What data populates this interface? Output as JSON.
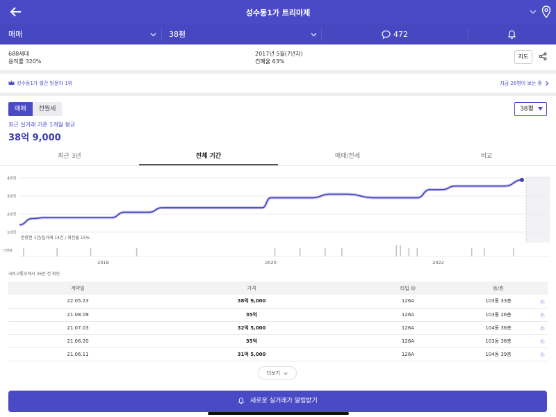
{
  "header": {
    "title": "성수동1가 트리마제"
  },
  "filters": {
    "type": "매매",
    "area": "38평",
    "comment_count": "472"
  },
  "info": {
    "households": "688세대",
    "floor_area_ratio": "용적률 320%",
    "built": "2017년 5월(7년차)",
    "coverage_ratio": "건폐율 63%",
    "map_button": "지도"
  },
  "rank": {
    "text": "성수동1가 월간 방문자 1위",
    "viewers": "지금 26명이 보는 중"
  },
  "trade_toggle": {
    "sale": "매매",
    "lease": "전월세"
  },
  "area_select": "38평",
  "average": {
    "label": "최근 실거래 기준 1개월 평균",
    "price": "38억 9,000"
  },
  "tabs": [
    "최근 3년",
    "전체 기간",
    "매매/전세",
    "비교"
  ],
  "chart_data": {
    "type": "line",
    "y_ticks": [
      "40억",
      "30억",
      "20억",
      "10억"
    ],
    "ylim": [
      10,
      40
    ],
    "x_ticks": [
      {
        "label": "2018",
        "t": 2018.0
      },
      {
        "label": "2020",
        "t": 2020.0
      },
      {
        "label": "2022",
        "t": 2022.0
      }
    ],
    "xlim": [
      2017.0,
      2023.05
    ],
    "series": [
      {
        "x": [
          2017.0,
          2017.15,
          2017.3,
          2017.6,
          2017.9,
          2018.1,
          2018.25,
          2018.4,
          2018.55,
          2018.7,
          2019.2,
          2019.7,
          2019.9,
          2020.0,
          2020.1,
          2020.5,
          2020.7,
          2020.9,
          2021.25,
          2021.45,
          2021.75,
          2021.9,
          2022.05,
          2022.2,
          2022.4,
          2022.8,
          2023.0
        ],
        "y": [
          14,
          17.5,
          18,
          18,
          18,
          18,
          21,
          21,
          21,
          23.5,
          23.5,
          23.5,
          23.5,
          29,
          29,
          29,
          31,
          31,
          29,
          29,
          29,
          33.5,
          33.5,
          35.5,
          35.5,
          35.5,
          38.9
        ]
      }
    ],
    "annotation": "분양권 1건/실거래 14건 / 회전율 15%",
    "volume_label": "거래량",
    "volume_marks": [
      2017.05,
      2017.45,
      2017.85,
      2018.4,
      2020.05,
      2020.35,
      2020.65,
      2020.85,
      2021.5,
      2021.55,
      2021.65,
      2021.75,
      2022.4,
      2022.55,
      2022.9
    ],
    "volume_heights": [
      0.5,
      0.5,
      0.5,
      0.5,
      0.5,
      0.5,
      0.5,
      0.5,
      1.0,
      1.0,
      0.5,
      0.5,
      0.5,
      0.5,
      0.5
    ]
  },
  "source": "국토교통부에서 36분 전 확인",
  "table": {
    "headers": [
      "계약일",
      "가격",
      "타입",
      "동/층"
    ],
    "rows": [
      [
        "22.05.23",
        "38억 9,000",
        "126A",
        "103동 33층"
      ],
      [
        "21.08.09",
        "35억",
        "126A",
        "103동 26층"
      ],
      [
        "21.07.03",
        "32억 5,000",
        "126A",
        "104동 36층"
      ],
      [
        "21.06.20",
        "35억",
        "126A",
        "103동 38층"
      ],
      [
        "21.06.11",
        "31억 5,000",
        "126A",
        "104동 39층"
      ]
    ]
  },
  "more_button": "더보기",
  "alert_button": "새로운 실거래가 알림받기",
  "colors": {
    "primary": "#4a4ac6",
    "line": "#3f3fbf"
  }
}
